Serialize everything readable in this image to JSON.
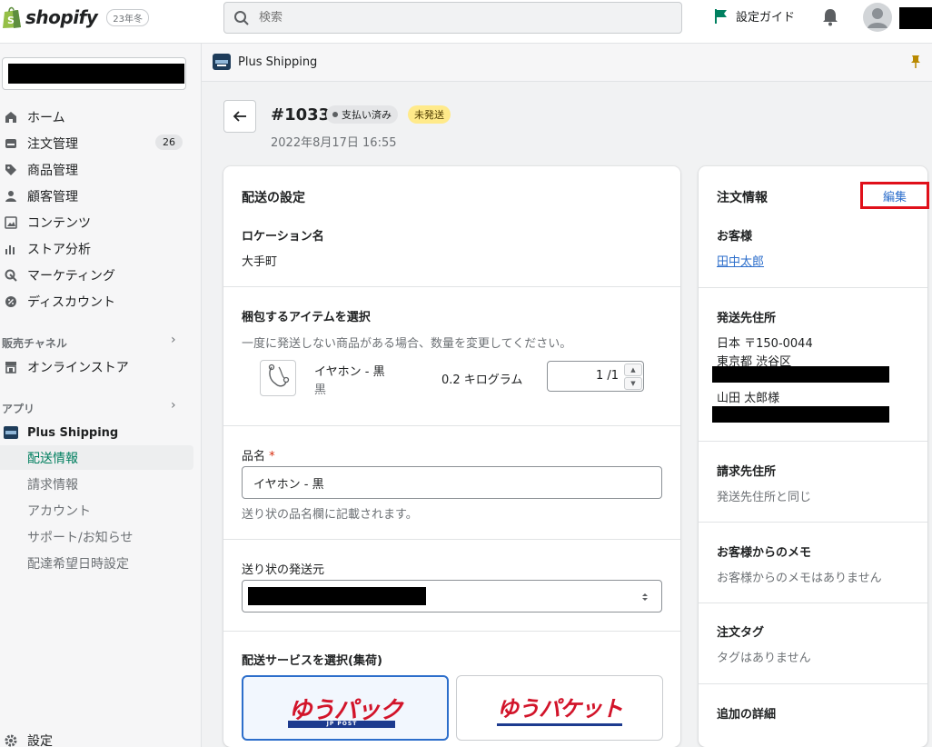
{
  "topbar": {
    "brand": "shopify",
    "edition": "23年冬",
    "search_placeholder": "検索",
    "setup_guide": "設定ガイド"
  },
  "sidebar": {
    "items": [
      {
        "label": "ホーム",
        "icon": "home-icon"
      },
      {
        "label": "注文管理",
        "icon": "orders-icon",
        "badge": "26"
      },
      {
        "label": "商品管理",
        "icon": "tag-icon"
      },
      {
        "label": "顧客管理",
        "icon": "customer-icon"
      },
      {
        "label": "コンテンツ",
        "icon": "content-icon"
      },
      {
        "label": "ストア分析",
        "icon": "analytics-icon"
      },
      {
        "label": "マーケティング",
        "icon": "marketing-icon"
      },
      {
        "label": "ディスカウント",
        "icon": "discount-icon"
      }
    ],
    "sales_channels_label": "販売チャネル",
    "online_store": "オンラインストア",
    "apps_label": "アプリ",
    "app_name": "Plus Shipping",
    "app_sub_items": [
      "配送情報",
      "請求情報",
      "アカウント",
      "サポート/お知らせ",
      "配達希望日時設定"
    ],
    "settings": "設定"
  },
  "app_header": {
    "name": "Plus Shipping"
  },
  "order": {
    "number": "#1033",
    "payment_status": "支払い済み",
    "fulfillment_status": "未発送",
    "date": "2022年8月17日 16:55"
  },
  "shipping": {
    "title": "配送の設定",
    "location_label": "ロケーション名",
    "location_value": "大手町",
    "items_label": "梱包するアイテムを選択",
    "items_help": "一度に発送しない商品がある場合、数量を変更してください。",
    "product_name": "イヤホン - 黒",
    "product_variant": "黒",
    "product_weight": "0.2 キログラム",
    "quantity": "1 /1",
    "item_name_label": "品名",
    "required_mark": "*",
    "item_name_value": "イヤホン - 黒",
    "item_name_help": "送り状の品名欄に記載されます。",
    "sender_label": "送り状の発送元",
    "service_label": "配送サービスを選択(集荷)",
    "service_1": "ゆうパック",
    "service_1_sub": "JP POST",
    "service_2": "ゆうパケット"
  },
  "order_info": {
    "title": "注文情報",
    "edit": "編集",
    "customer_label": "お客様",
    "customer_name": "田中太郎",
    "ship_to_label": "発送先住所",
    "ship_country_zip": "日本 〒150-0044",
    "ship_city": "東京都 渋谷区",
    "ship_name": "山田 太郎様",
    "billing_label": "請求先住所",
    "billing_value": "発送先住所と同じ",
    "note_label": "お客様からのメモ",
    "note_value": "お客様からのメモはありません",
    "tags_label": "注文タグ",
    "tags_value": "タグはありません",
    "details_label": "追加の詳細"
  },
  "colors": {
    "accent_green": "#007f5f",
    "link_blue": "#2c6ecb",
    "highlight_red": "#e0101a",
    "unfulfilled_yellow": "#ffea8a"
  }
}
